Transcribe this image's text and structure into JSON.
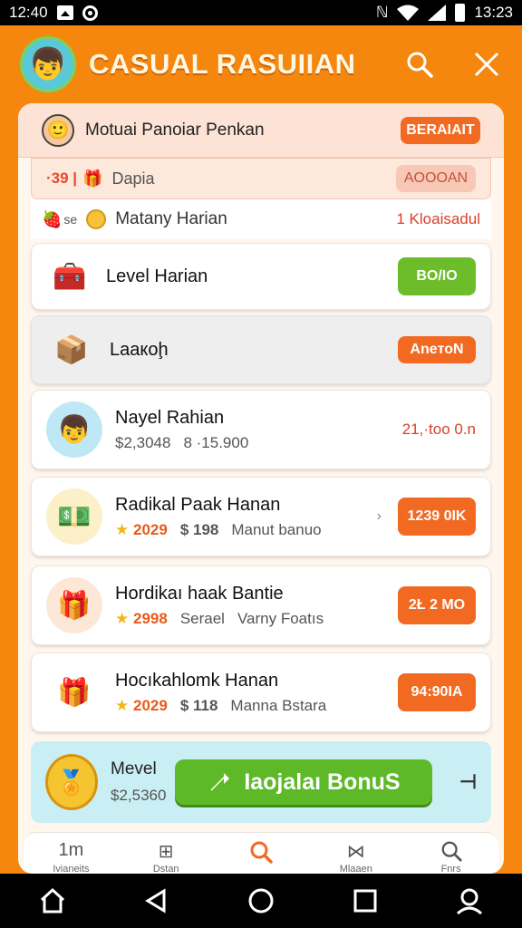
{
  "status_bar": {
    "time_left": "12:40",
    "time_right": "13:23"
  },
  "header": {
    "title": "CASUAL RASUIIAN"
  },
  "top_sheet": {
    "text": "Motuai Panoiar Penkan",
    "badge": "BERAIAIT"
  },
  "peek_row": {
    "number": "·39 |",
    "label": "Dapia",
    "badge": "AOOOAN"
  },
  "plain_row": {
    "prefix": "se",
    "label": "Matany Harian",
    "right": "1 Kloaisadul"
  },
  "cards": [
    {
      "title": "Level Harian",
      "action": "BO/IO",
      "action_color": "#6dbd2a"
    },
    {
      "title": "Laaкоḩ",
      "action": "AneтоN",
      "action_color": "#f26a22"
    },
    {
      "title": "Nayel Rahian",
      "sub_a": "$2,3048",
      "sub_b": "8 ·15.900",
      "right": "21,·too 0.n"
    },
    {
      "title": "Radikal Paak Hanan",
      "price": "2029",
      "cash": "$ 198",
      "note": "Manut banuo",
      "action": "1239 0IK",
      "action_color": "#f26a22"
    },
    {
      "title": "Hordikaı haak Bantie",
      "price": "2998",
      "cash": "Serael",
      "note": "Varny Foatıs",
      "action": "2Ł 2 MO",
      "action_color": "#f26a22"
    },
    {
      "title": "Hocıkahlomk Hanan",
      "price": "2029",
      "cash": "$ 118",
      "note": "Manna Bstara",
      "action": "94:90IA",
      "action_color": "#f26a22"
    }
  ],
  "bonus": {
    "title": "Mevel",
    "value": "$2,5360",
    "button": "Iaojalaı BonuS",
    "tail": "⊣"
  },
  "bottom_nav": [
    {
      "label": "Ivianeits",
      "icon": "1m"
    },
    {
      "label": "Dstan",
      "icon": "⊞"
    },
    {
      "label": "",
      "icon": "search"
    },
    {
      "label": "Mlaaen",
      "icon": "⋈"
    },
    {
      "label": "Fnrs",
      "icon": "search"
    }
  ],
  "colors": {
    "brand_orange": "#f5870f",
    "accent_green": "#6dbd2a",
    "accent_red": "#f26a22"
  }
}
